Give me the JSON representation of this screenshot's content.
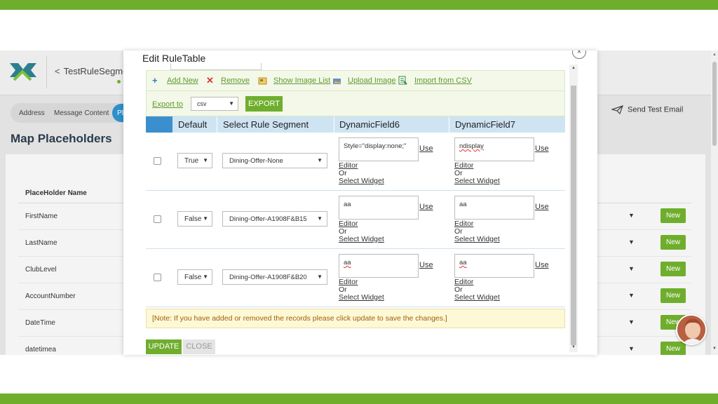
{
  "app": {
    "back_label": "TestRuleSegme",
    "tabs": [
      "Address",
      "Message Content",
      "Pl"
    ],
    "send_test_label": "Send Test Email",
    "page_title": "Map Placeholders",
    "placeholder_header": "PlaceHolder Name",
    "placeholders": [
      "FirstName",
      "LastName",
      "ClubLevel",
      "AccountNumber",
      "DateTime",
      "datetimea"
    ],
    "new_label": "New",
    "caret": "▼"
  },
  "modal": {
    "title": "Edit RuleTable",
    "close_glyph": "×",
    "toolbar": {
      "add_new": "Add New",
      "remove": "Remove",
      "show_image_list": "Show Image List",
      "upload_image": "Upload Image",
      "import_csv": "Import from CSV",
      "export_to": "Export to",
      "format_value": "csv",
      "export_button": "EXPORT"
    },
    "columns": [
      "Default",
      "Select Rule Segment",
      "DynamicField6",
      "DynamicField7"
    ],
    "rows": [
      {
        "default": "True",
        "segment": "Dining-Offer-None",
        "field6": "Style=\"display:none;\"",
        "field7": "ndisplay"
      },
      {
        "default": "False",
        "segment": "Dining-Offer-A1908F&B15",
        "field6": "aa",
        "field7": "aa"
      },
      {
        "default": "False",
        "segment": "Dining-Offer-A1908F&B20",
        "field6": "aa",
        "field7": "aa"
      }
    ],
    "use_label": "Use",
    "editor_label": "Editor",
    "or_label": "Or",
    "select_widget_label": "Select Widget",
    "note": "[Note: If you have added or removed the records please click update to save the changes.]",
    "update_button": "UPDATE",
    "close_button": "CLOSE"
  },
  "colors": {
    "brand_green": "#6fae2d",
    "header_blue": "#3b8fcf",
    "column_header_bg": "#cfe4f3",
    "note_bg": "#fdf8d6"
  }
}
